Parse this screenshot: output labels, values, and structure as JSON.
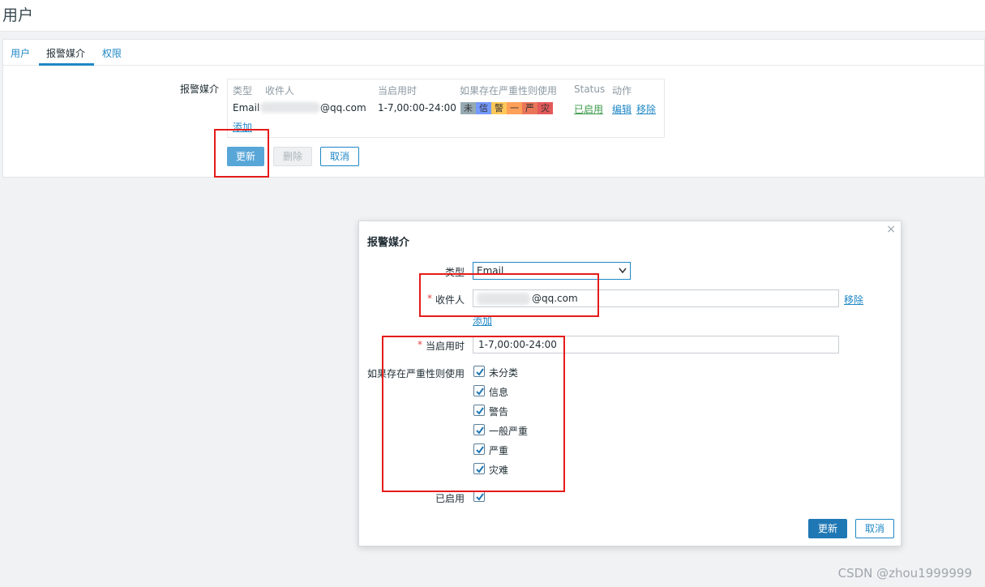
{
  "page": {
    "title": "用户"
  },
  "tabs": [
    {
      "label": "用户"
    },
    {
      "label": "报警媒介"
    },
    {
      "label": "权限"
    }
  ],
  "media_table": {
    "section_label": "报警媒介",
    "headers": [
      "类型",
      "收件人",
      "当启用时",
      "如果存在严重性则使用",
      "Status",
      "动作"
    ],
    "row": {
      "type": "Email",
      "recipient_suffix": "@qq.com",
      "when_active": "1-7,00:00-24:00",
      "severities": [
        "未",
        "信",
        "警",
        "一",
        "严",
        "灾"
      ],
      "status": "已启用",
      "edit": "编辑",
      "remove": "移除"
    },
    "add_link": "添加"
  },
  "form_buttons": {
    "update": "更新",
    "delete": "删除",
    "cancel": "取消"
  },
  "dialog": {
    "title": "报警媒介",
    "close": "×",
    "type_label": "类型",
    "type_value": "Email",
    "recipient_label": "收件人",
    "recipient_value_suffix": "@qq.com",
    "recipient_remove": "移除",
    "recipient_add": "添加",
    "when_active_label": "当启用时",
    "when_active_value": "1-7,00:00-24:00",
    "severity_label": "如果存在严重性则使用",
    "severities": [
      "未分类",
      "信息",
      "警告",
      "一般严重",
      "严重",
      "灾难"
    ],
    "enabled_label": "已启用",
    "update": "更新",
    "cancel": "取消"
  },
  "watermark": "CSDN @zhou1999999",
  "colors": {
    "sev_not_classified": "#97aab3",
    "sev_information": "#7499ff",
    "sev_warning": "#ffc859",
    "sev_average": "#ffa059",
    "sev_high": "#e97659",
    "sev_disaster": "#e45959"
  }
}
